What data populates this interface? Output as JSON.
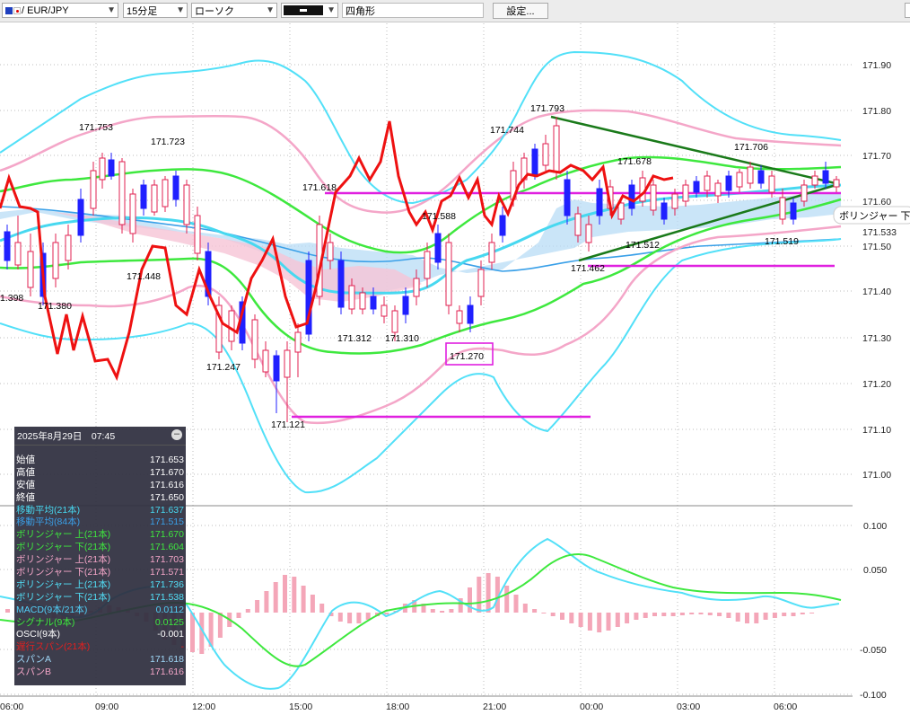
{
  "toolbar": {
    "symbol": "/ EUR/JPY",
    "timeframe": "15分足",
    "chart_type": "ローソク",
    "drawing_tool": "四角形",
    "settings_label": "設定..."
  },
  "price_axis": [
    "171.90",
    "171.80",
    "171.70",
    "171.60",
    "171.50",
    "171.40",
    "171.30",
    "171.20",
    "171.10",
    "171.00"
  ],
  "price_tags": [
    "171.533"
  ],
  "time_axis": [
    "06:00",
    "09:00",
    "12:00",
    "15:00",
    "18:00",
    "21:00",
    "00:00",
    "03:00",
    "06:00"
  ],
  "macd_axis": [
    "0.100",
    "0.050",
    "-0.050",
    "-0.100"
  ],
  "annotations": [
    "1.398",
    "171.380",
    "171.753",
    "171.448",
    "171.723",
    "171.247",
    "171.121",
    "171.618",
    "171.312",
    "171.310",
    "171.588",
    "171.270",
    "171.744",
    "171.793",
    "171.462",
    "171.678",
    "171.512",
    "171.706",
    "171.519"
  ],
  "tooltip_label": "ボリンジャー 下(",
  "info_panel": {
    "datetime": "2025年8月29日　07:45",
    "minimize": "–",
    "rows": [
      {
        "label": "始値",
        "value": "171.653",
        "color": "#ffffff"
      },
      {
        "label": "高値",
        "value": "171.670",
        "color": "#ffffff"
      },
      {
        "label": "安値",
        "value": "171.616",
        "color": "#ffffff"
      },
      {
        "label": "終値",
        "value": "171.650",
        "color": "#ffffff"
      },
      {
        "label": "移動平均(21本)",
        "value": "171.637",
        "color": "#47d8f0"
      },
      {
        "label": "移動平均(84本)",
        "value": "171.515",
        "color": "#3aa0e8"
      },
      {
        "label": "ボリンジャー 上(21本)",
        "value": "171.670",
        "color": "#3ee83e"
      },
      {
        "label": "ボリンジャー 下(21本)",
        "value": "171.604",
        "color": "#3ee83e"
      },
      {
        "label": "ボリンジャー 上(21本)",
        "value": "171.703",
        "color": "#f4a6c8"
      },
      {
        "label": "ボリンジャー 下(21本)",
        "value": "171.571",
        "color": "#f4a6c8"
      },
      {
        "label": "ボリンジャー 上(21本)",
        "value": "171.736",
        "color": "#52e0f8"
      },
      {
        "label": "ボリンジャー 下(21本)",
        "value": "171.538",
        "color": "#52e0f8"
      },
      {
        "label": "MACD(9本/21本)",
        "value": "0.0112",
        "color": "#52d0f8"
      },
      {
        "label": "シグナル(9本)",
        "value": "0.0125",
        "color": "#3ee83e"
      },
      {
        "label": "OSCI(9本)",
        "value": "-0.001",
        "color": "#ffffff"
      },
      {
        "label": "遅行スパン(21本)",
        "value": "-",
        "color": "#e02020"
      },
      {
        "label": "スパンA",
        "value": "171.618",
        "color": "#a0d8f8"
      },
      {
        "label": "スパンB",
        "value": "171.616",
        "color": "#f4a6c8"
      }
    ]
  },
  "colors": {
    "bull_candle": "#3030e8",
    "bear_candle": "#2020ff",
    "bollinger_1": "#3ee83e",
    "bollinger_2": "#f4a6c8",
    "bollinger_3": "#52e0f8",
    "lagging_span": "#ee1111",
    "ma_fast": "#47d8f0",
    "ma_slow": "#3aa0e8",
    "magenta_lines": "#e020e0",
    "trend_lines": "#1a7a1a",
    "osci": "#f4a6b8"
  }
}
